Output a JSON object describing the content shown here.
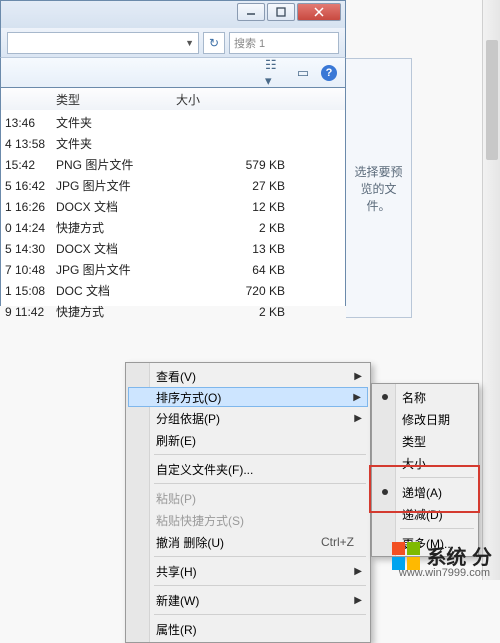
{
  "window": {
    "search_placeholder": "搜索 1"
  },
  "columns": {
    "type": "类型",
    "size": "大小"
  },
  "files": [
    {
      "date": "13:46",
      "type": "文件夹",
      "size": ""
    },
    {
      "date": "4 13:58",
      "type": "文件夹",
      "size": ""
    },
    {
      "date": "15:42",
      "type": "PNG 图片文件",
      "size": "579 KB"
    },
    {
      "date": "5 16:42",
      "type": "JPG 图片文件",
      "size": "27 KB"
    },
    {
      "date": "1 16:26",
      "type": "DOCX 文档",
      "size": "12 KB"
    },
    {
      "date": "0 14:24",
      "type": "快捷方式",
      "size": "2 KB"
    },
    {
      "date": "5 14:30",
      "type": "DOCX 文档",
      "size": "13 KB"
    },
    {
      "date": "7 10:48",
      "type": "JPG 图片文件",
      "size": "64 KB"
    },
    {
      "date": "1 15:08",
      "type": "DOC 文档",
      "size": "720 KB"
    },
    {
      "date": "9 11:42",
      "type": "快捷方式",
      "size": "2 KB"
    }
  ],
  "preview_text": "选择要预览的文件。",
  "context_menu": [
    {
      "label": "查看(V)",
      "sub": true
    },
    {
      "label": "排序方式(O)",
      "sub": true,
      "active": true
    },
    {
      "label": "分组依据(P)",
      "sub": true
    },
    {
      "label": "刷新(E)"
    },
    {
      "sep": true
    },
    {
      "label": "自定义文件夹(F)..."
    },
    {
      "sep": true
    },
    {
      "label": "粘贴(P)",
      "disabled": true
    },
    {
      "label": "粘贴快捷方式(S)",
      "disabled": true
    },
    {
      "label": "撤消 删除(U)",
      "shortcut": "Ctrl+Z"
    },
    {
      "sep": true
    },
    {
      "label": "共享(H)",
      "sub": true
    },
    {
      "sep": true
    },
    {
      "label": "新建(W)",
      "sub": true
    },
    {
      "sep": true
    },
    {
      "label": "属性(R)"
    }
  ],
  "sort_submenu": [
    {
      "label": "名称",
      "bullet": true
    },
    {
      "label": "修改日期"
    },
    {
      "label": "类型"
    },
    {
      "label": "大小"
    },
    {
      "sep": true
    },
    {
      "label": "递增(A)",
      "bullet": true
    },
    {
      "label": "递减(D)"
    },
    {
      "sep": true
    },
    {
      "label": "更多(M)..."
    }
  ],
  "watermark": {
    "text": "系统 分",
    "url": "www.win7999.com"
  }
}
